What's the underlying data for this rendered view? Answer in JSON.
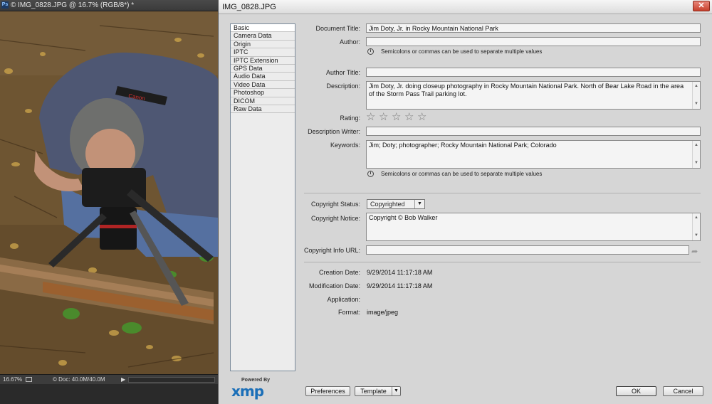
{
  "ps_window": {
    "tab_title": "© IMG_0828.JPG @ 16.7% (RGB/8*) *",
    "app_icon_text": "Ps",
    "status": {
      "zoom": "16.67%",
      "doc_info": "© Doc: 40.0M/40.0M",
      "arrow": "▶"
    }
  },
  "dialog": {
    "title": "IMG_0828.JPG",
    "close_glyph": "✕",
    "sidebar": {
      "items": [
        {
          "label": "Basic",
          "active": true
        },
        {
          "label": "Camera Data"
        },
        {
          "label": "Origin"
        },
        {
          "label": "IPTC"
        },
        {
          "label": "IPTC Extension"
        },
        {
          "label": "GPS Data"
        },
        {
          "label": "Audio Data"
        },
        {
          "label": "Video Data"
        },
        {
          "label": "Photoshop"
        },
        {
          "label": "DICOM"
        },
        {
          "label": "Raw Data"
        }
      ]
    },
    "xmp": {
      "powered_by": "Powered By",
      "mark": "xmp"
    },
    "fields": {
      "document_title": {
        "label": "Document Title:",
        "value": "Jim Doty, Jr. in Rocky Mountain National Park"
      },
      "author": {
        "label": "Author:",
        "value": ""
      },
      "author_hint": "Semicolons or commas can be used to separate multiple values",
      "author_title": {
        "label": "Author Title:",
        "value": ""
      },
      "description": {
        "label": "Description:",
        "value": "Jim Doty, Jr. doing closeup photography in Rocky Mountain National Park. North of Bear Lake Road in the area of the Storm Pass Trail parking lot."
      },
      "rating": {
        "label": "Rating:",
        "stars_filled": 0,
        "stars_total": 5,
        "star_glyph": "☆"
      },
      "description_writer": {
        "label": "Description Writer:",
        "value": ""
      },
      "keywords": {
        "label": "Keywords:",
        "value": "Jim; Doty; photographer; Rocky Mountain National Park; Colorado"
      },
      "keywords_hint": "Semicolons or commas can be used to separate multiple values",
      "copyright_status": {
        "label": "Copyright Status:",
        "value": "Copyrighted"
      },
      "copyright_notice": {
        "label": "Copyright Notice:",
        "value": "Copyright © Bob Walker"
      },
      "copyright_url": {
        "label": "Copyright Info URL:",
        "value": ""
      },
      "creation_date": {
        "label": "Creation Date:",
        "value": "9/29/2014 11:17:18 AM"
      },
      "modification_date": {
        "label": "Modification Date:",
        "value": "9/29/2014 11:17:18 AM"
      },
      "application": {
        "label": "Application:",
        "value": ""
      },
      "format": {
        "label": "Format:",
        "value": "image/jpeg"
      }
    },
    "buttons": {
      "preferences": "Preferences",
      "template": "Template",
      "ok": "OK",
      "cancel": "Cancel"
    },
    "icons": {
      "info": "info-icon",
      "go": "go-arrow-icon",
      "scroll_up": "▲",
      "scroll_down": "▼"
    }
  }
}
